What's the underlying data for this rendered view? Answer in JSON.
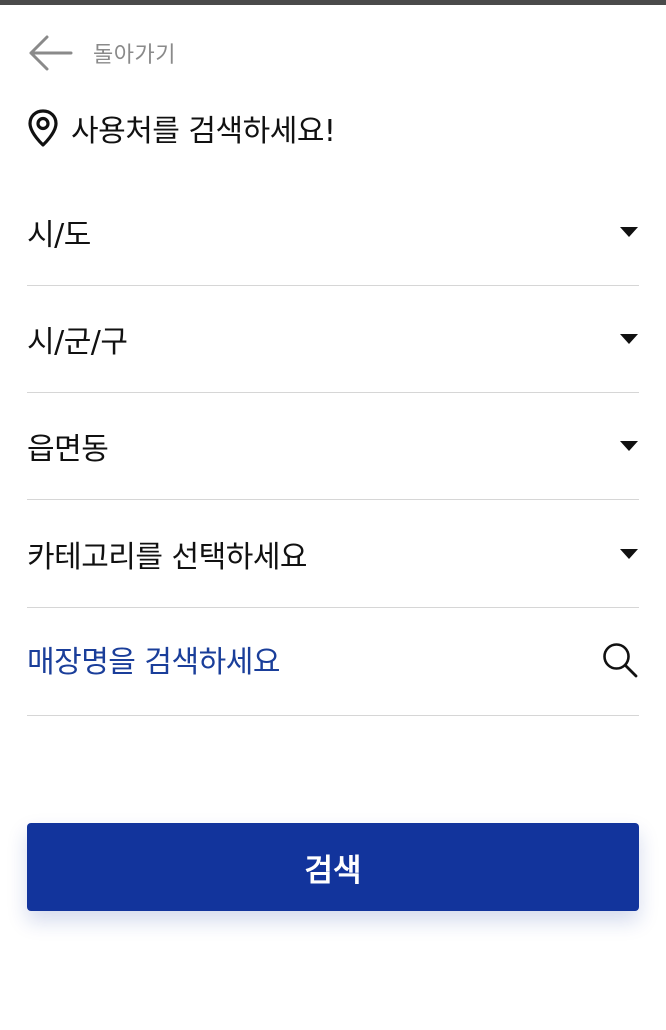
{
  "header": {
    "back_label": "돌아가기",
    "back_icon": "arrow-left-icon",
    "title": "사용처를 검색하세요!",
    "title_icon": "location-pin-icon"
  },
  "filters": [
    {
      "label": "시/도",
      "icon": "caret-down-icon"
    },
    {
      "label": "시/군/구",
      "icon": "caret-down-icon"
    },
    {
      "label": "읍면동",
      "icon": "caret-down-icon"
    },
    {
      "label": "카테고리를 선택하세요",
      "icon": "caret-down-icon"
    }
  ],
  "search": {
    "placeholder": "매장명을 검색하세요",
    "value": "",
    "icon": "search-icon"
  },
  "submit": {
    "label": "검색"
  },
  "colors": {
    "accent": "#12349c",
    "placeholder_text": "#1a3e9a",
    "back_text": "#8a8a8a",
    "divider": "#d6d6d6"
  }
}
